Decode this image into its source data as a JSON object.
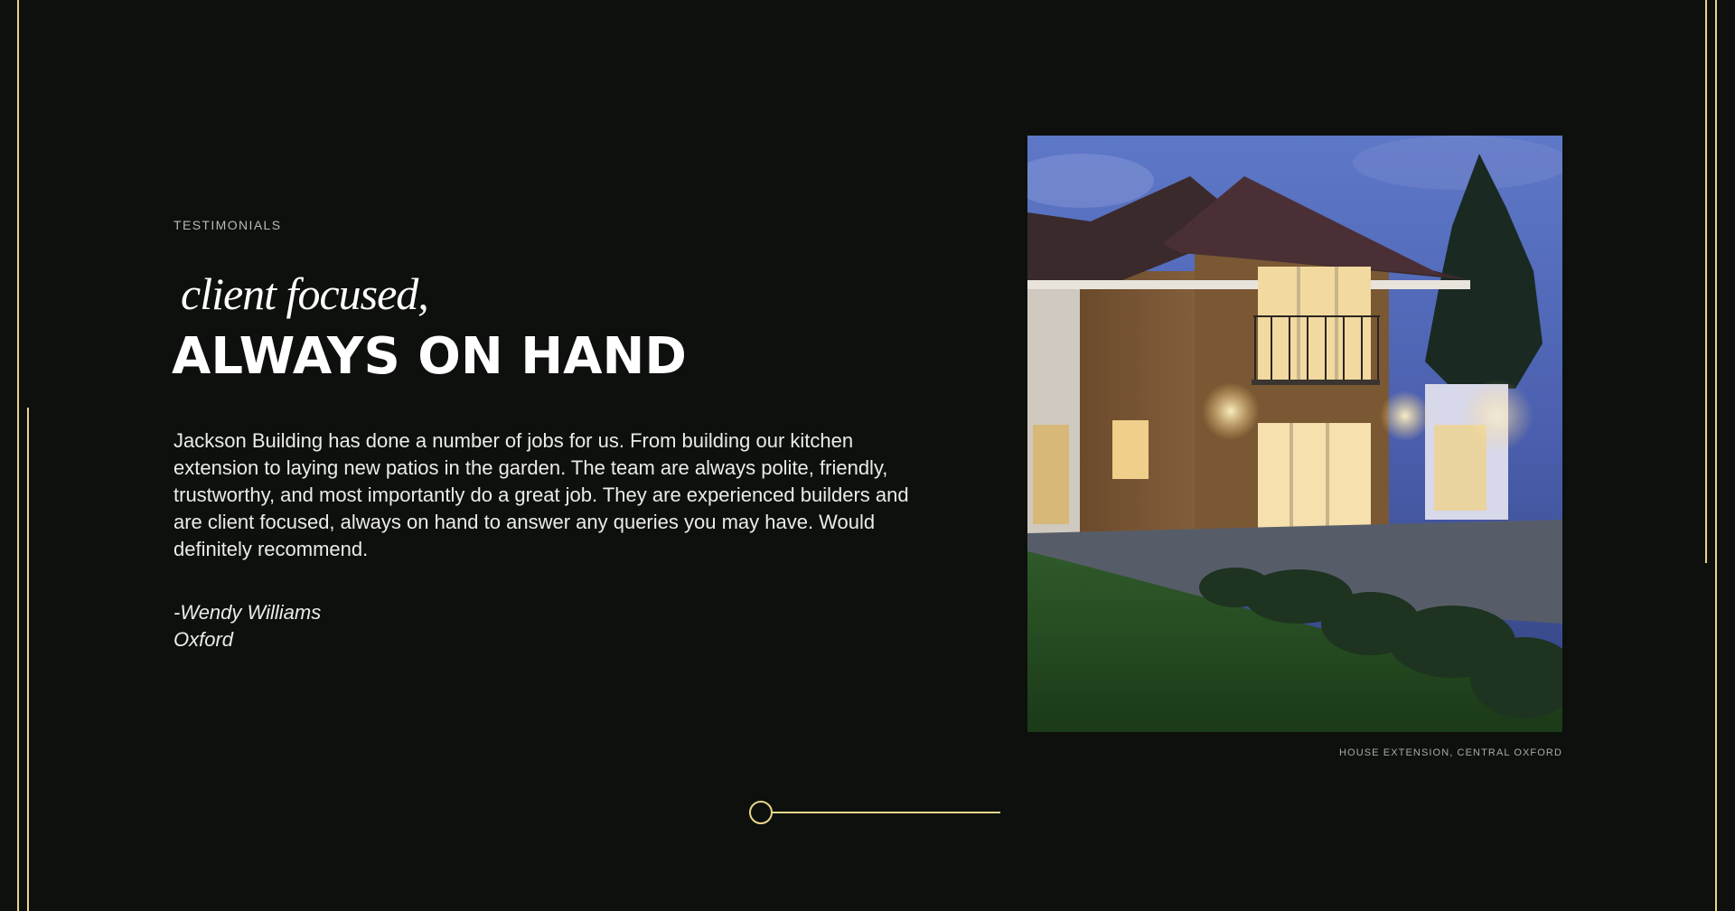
{
  "section": {
    "eyebrow": "TESTIMONIALS",
    "heading_script": "client focused,",
    "heading_main": "ALWAYS ON HAND"
  },
  "testimonial": {
    "quote": "Jackson Building has done a number of jobs for us. From building our kitchen extension to laying new patios in the garden. The team are always polite, friendly, trustworthy, and most importantly do a great job. They are experienced builders and are client focused, always on  hand to answer any queries you may have. Would definitely recommend.",
    "author": "-Wendy Williams",
    "location": "Oxford"
  },
  "image": {
    "caption": "HOUSE EXTENSION, CENTRAL OXFORD"
  },
  "slider": {
    "position": 0.0
  },
  "colors": {
    "background": "#0d100c",
    "accent": "#e8d58a",
    "text": "#ffffff"
  }
}
